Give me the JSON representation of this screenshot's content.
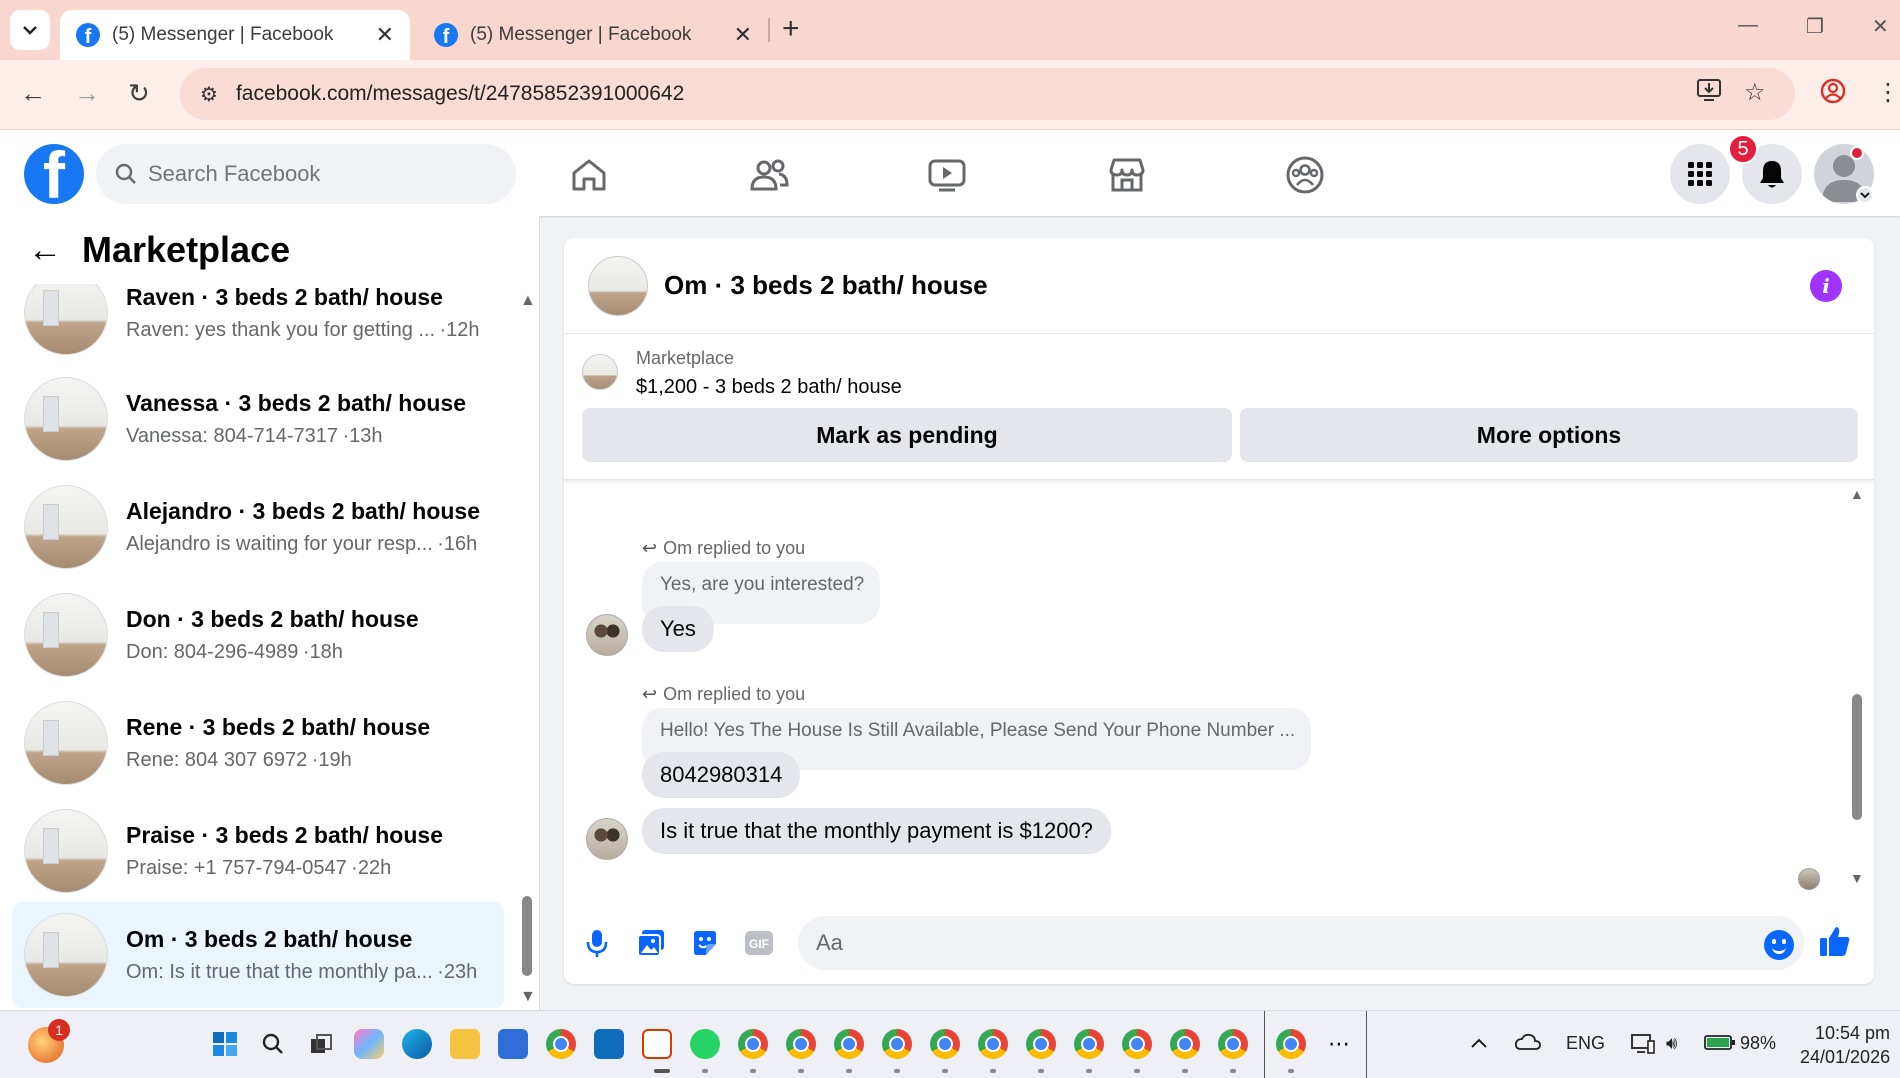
{
  "browser": {
    "tabs": [
      {
        "title": "(5) Messenger | Facebook",
        "active": true
      },
      {
        "title": "(5) Messenger | Facebook",
        "active": false
      }
    ],
    "new_tab_symbol": "+",
    "url": "facebook.com/messages/t/24785852391000642"
  },
  "fb_header": {
    "logo_letter": "f",
    "search_placeholder": "Search Facebook",
    "nav_icons": [
      "home-icon",
      "friends-icon",
      "video-icon",
      "marketplace-icon",
      "groups-icon"
    ],
    "notification_count": "5"
  },
  "left_pane": {
    "back_symbol": "←",
    "title": "Marketplace",
    "conversations": [
      {
        "name": "Raven · 3 beds 2 bath/ house",
        "preview": "Raven: yes thank you for getting ...",
        "time": "·12h",
        "selected": false
      },
      {
        "name": "Vanessa · 3 beds 2 bath/ house",
        "preview": "Vanessa: 804-714-7317",
        "time": "·13h",
        "selected": false
      },
      {
        "name": "Alejandro · 3 beds 2 bath/ house",
        "preview": "Alejandro is waiting for your resp...",
        "time": "·16h",
        "selected": false
      },
      {
        "name": "Don · 3 beds 2 bath/ house",
        "preview": "Don: 804-296-4989",
        "time": "·18h",
        "selected": false
      },
      {
        "name": "Rene · 3 beds 2 bath/ house",
        "preview": "Rene: 804 307 6972",
        "time": "·19h",
        "selected": false
      },
      {
        "name": "Praise · 3 beds 2 bath/ house",
        "preview": "Praise: +1 757-794-0547",
        "time": "·22h",
        "selected": false
      },
      {
        "name": "Om · 3 beds 2 bath/ house",
        "preview": "Om: Is it true that the monthly pa...",
        "time": "·23h",
        "selected": true
      }
    ]
  },
  "chat": {
    "title": "Om · 3 beds 2 bath/ house",
    "marketplace": {
      "label": "Marketplace",
      "listing": "$1,200 - 3 beds 2 bath/ house",
      "mark_pending_label": "Mark as pending",
      "more_options_label": "More options"
    },
    "messages": [
      {
        "reply_note": "Om replied to you",
        "quoted": "Yes, are you interested?",
        "text": "Yes"
      },
      {
        "reply_note": "Om replied to you",
        "quoted": "Hello! Yes The House  Is Still Available, Please Send Your Phone Number ...",
        "text": "8042980314"
      },
      {
        "text": "Is it true that the monthly payment is $1200?"
      }
    ],
    "composer_placeholder": "Aa",
    "accent_color": "#0866ff"
  },
  "taskbar": {
    "weather_badge": "1",
    "language": "ENG",
    "battery": "98%",
    "time": "10:54 pm",
    "date": "24/01/2026"
  }
}
